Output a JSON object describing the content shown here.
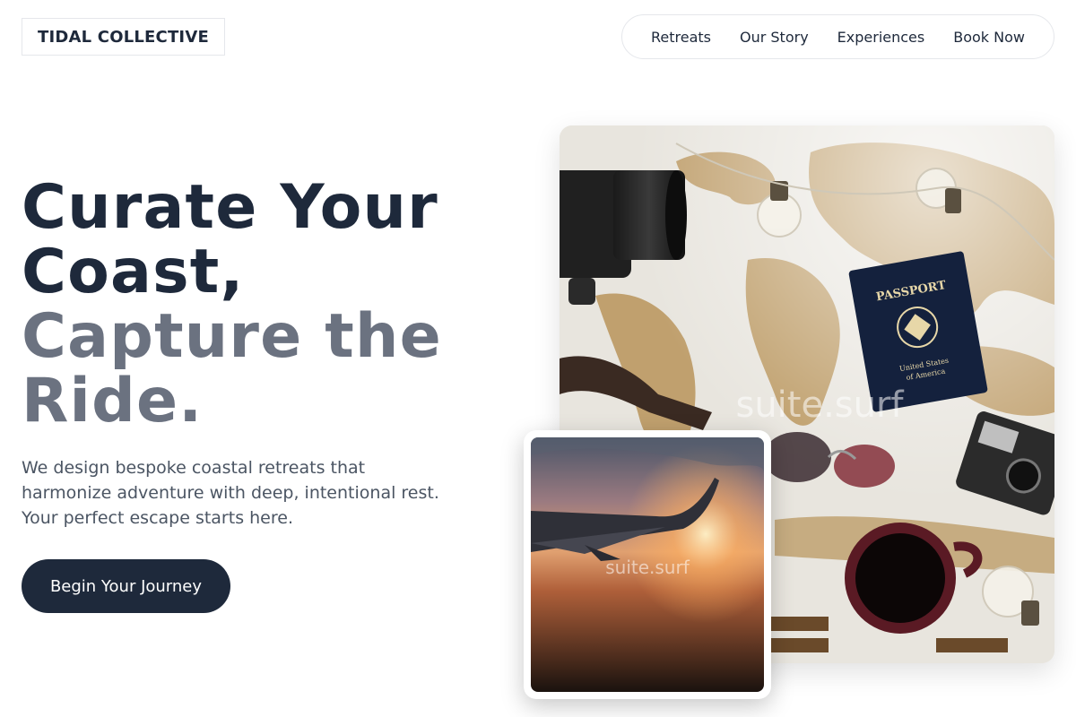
{
  "brand": {
    "name": "TIDAL COLLECTIVE"
  },
  "nav": {
    "items": [
      {
        "label": "Retreats"
      },
      {
        "label": "Our Story"
      },
      {
        "label": "Experiences"
      },
      {
        "label": "Book Now"
      }
    ]
  },
  "hero": {
    "headline_dark": [
      "Curate Your",
      "Coast,"
    ],
    "headline_muted": [
      "Capture the",
      "Ride."
    ],
    "description": "We design bespoke coastal retreats that harmonize adventure with deep, intentional rest. Your perfect escape starts here.",
    "cta_label": "Begin Your Journey"
  },
  "media": {
    "main_photo": {
      "watermark": "suite.surf",
      "passport_title": "PASSPORT",
      "passport_country": [
        "United States",
        "of America"
      ]
    },
    "wing_photo": {
      "watermark": "suite.surf"
    }
  },
  "colors": {
    "primary": "#1e293b",
    "muted": "#6b7280",
    "body_text": "#4b5563",
    "border": "#e5e7eb"
  }
}
